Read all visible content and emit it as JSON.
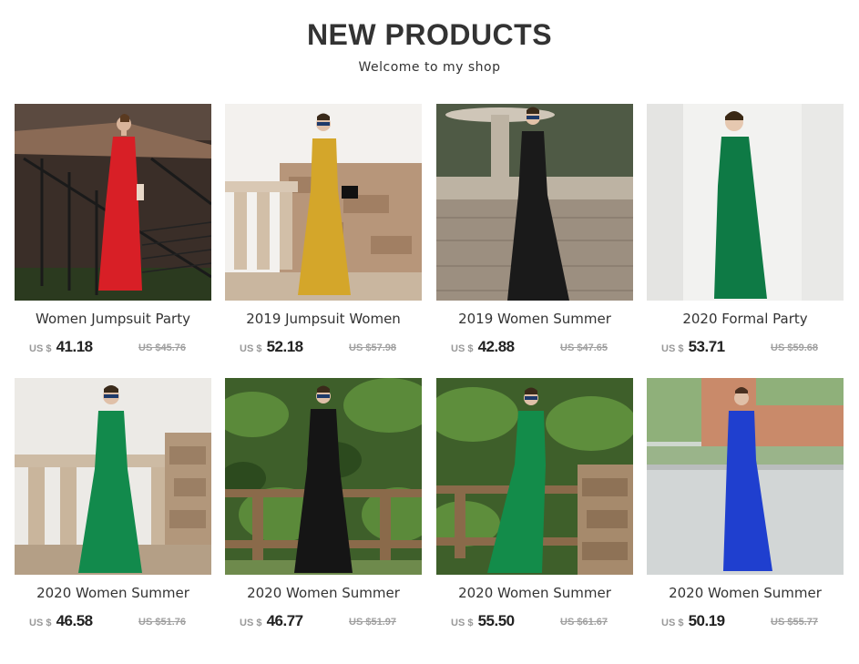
{
  "header": {
    "title": "NEW PRODUCTS",
    "subtitle": "Welcome to my shop"
  },
  "products": [
    {
      "name": "Women Jumpsuit Party",
      "currency": "US $",
      "price": "41.18",
      "old_price": "US $45.76",
      "garment_color": "#d81f26",
      "scene": "staircase"
    },
    {
      "name": "2019 Jumpsuit Women",
      "currency": "US $",
      "price": "52.18",
      "old_price": "US $57.98",
      "garment_color": "#d4a62a",
      "scene": "stone-wall"
    },
    {
      "name": "2019 Women Summer",
      "currency": "US $",
      "price": "42.88",
      "old_price": "US $47.65",
      "garment_color": "#1a1a1a",
      "scene": "fountain-plaza"
    },
    {
      "name": "2020 Formal Party",
      "currency": "US $",
      "price": "53.71",
      "old_price": "US $59.68",
      "garment_color": "#0e7a45",
      "scene": "white-wall"
    },
    {
      "name": "2020 Women Summer",
      "currency": "US $",
      "price": "46.58",
      "old_price": "US $51.76",
      "garment_color": "#128a4c",
      "scene": "balustrade"
    },
    {
      "name": "2020 Women Summer",
      "currency": "US $",
      "price": "46.77",
      "old_price": "US $51.97",
      "garment_color": "#151515",
      "scene": "palm-fence"
    },
    {
      "name": "2020 Women Summer",
      "currency": "US $",
      "price": "55.50",
      "old_price": "US $61.67",
      "garment_color": "#138c4a",
      "scene": "palm-fence-stone"
    },
    {
      "name": "2020 Women Summer",
      "currency": "US $",
      "price": "50.19",
      "old_price": "US $55.77",
      "garment_color": "#1f3fcf",
      "scene": "street"
    }
  ]
}
